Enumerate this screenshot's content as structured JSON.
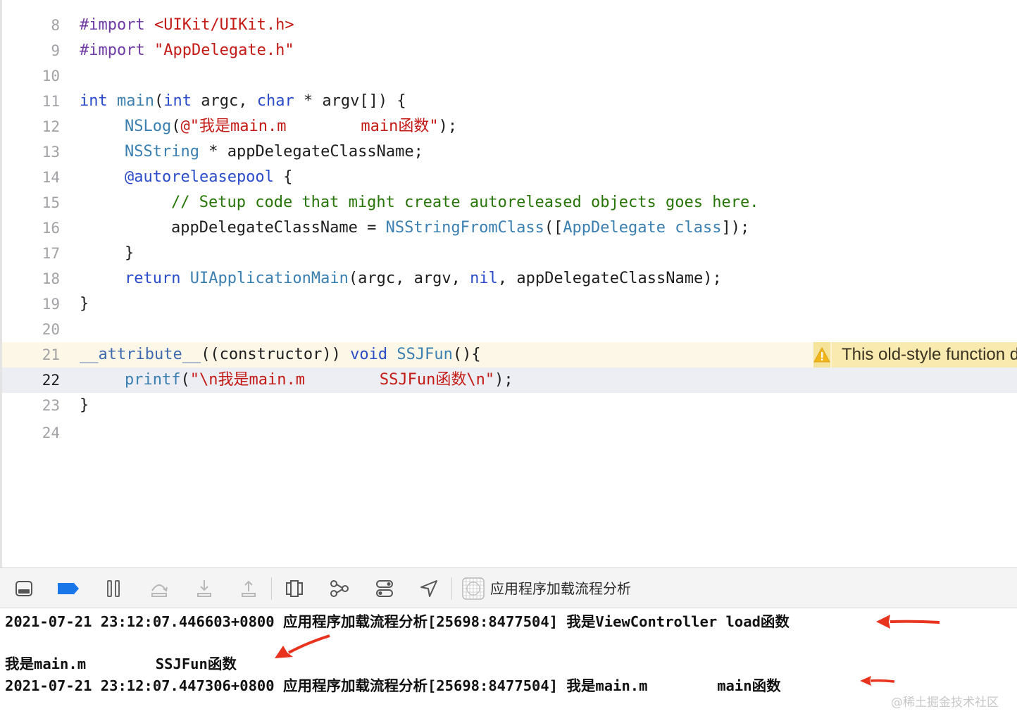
{
  "editor": {
    "lines": [
      {
        "n": "8"
      },
      {
        "n": "9"
      },
      {
        "n": "10"
      },
      {
        "n": "11"
      },
      {
        "n": "12"
      },
      {
        "n": "13"
      },
      {
        "n": "14"
      },
      {
        "n": "15"
      },
      {
        "n": "16"
      },
      {
        "n": "17"
      },
      {
        "n": "18"
      },
      {
        "n": "19"
      },
      {
        "n": "20"
      },
      {
        "n": "21"
      },
      {
        "n": "22"
      },
      {
        "n": "23"
      },
      {
        "n": "24"
      }
    ],
    "code": {
      "l8_a": "#import",
      "l8_b": "<UIKit/UIKit.h>",
      "l9_a": "#import",
      "l9_b": "\"AppDelegate.h\"",
      "l11_a": "int",
      "l11_b": "main",
      "l11_c": "(",
      "l11_d": "int",
      "l11_e": " argc, ",
      "l11_f": "char",
      "l11_g": " * argv[]) {",
      "l12_a": "NSLog",
      "l12_b": "(",
      "l12_c": "@\"我是main.m        main函数\"",
      "l12_d": ");",
      "l13_a": "NSString",
      "l13_b": " * appDelegateClassName;",
      "l14_a": "@autoreleasepool",
      "l14_b": " {",
      "l15_a": "// Setup code that might create autoreleased objects goes here.",
      "l16_a": "appDelegateClassName = ",
      "l16_b": "NSStringFromClass",
      "l16_c": "([",
      "l16_d": "AppDelegate",
      "l16_e": " ",
      "l16_f": "class",
      "l16_g": "]);",
      "l17_a": "}",
      "l18_a": "return",
      "l18_b": " ",
      "l18_c": "UIApplicationMain",
      "l18_d": "(argc, argv, ",
      "l18_e": "nil",
      "l18_f": ", appDelegateClassName);",
      "l19_a": "}",
      "l21_a": "__attribute__",
      "l21_b": "((constructor)) ",
      "l21_c": "void",
      "l21_d": " ",
      "l21_e": "SSJFun",
      "l21_f": "()",
      "l21_g": "{",
      "l22_a": "printf",
      "l22_b": "(",
      "l22_c": "\"\\n我是main.m        SSJFun函数\\n\"",
      "l22_d": ");",
      "l23_a": "}"
    },
    "warning": {
      "icon": "warning-triangle-icon",
      "text": "This old-style function definition is not preceded by a prototype"
    }
  },
  "debug_bar": {
    "buttons": [
      {
        "name": "hide-debug-area-icon"
      },
      {
        "name": "breakpoints-toggle-icon"
      },
      {
        "name": "pause-icon"
      },
      {
        "name": "step-over-icon"
      },
      {
        "name": "step-into-icon"
      },
      {
        "name": "step-out-icon"
      },
      {
        "name": "view-hierarchy-icon"
      },
      {
        "name": "memory-graph-icon"
      },
      {
        "name": "environment-overrides-icon"
      },
      {
        "name": "simulate-location-icon"
      }
    ],
    "process_label": "应用程序加载流程分析"
  },
  "console": {
    "lines": [
      "2021-07-21 23:12:07.446603+0800 应用程序加载流程分析[25698:8477504] 我是ViewController load函数",
      "我是main.m        SSJFun函数",
      "2021-07-21 23:12:07.447306+0800 应用程序加载流程分析[25698:8477504] 我是main.m        main函数"
    ],
    "watermark": "@稀土掘金技术社区"
  },
  "colors": {
    "keyword": "#9b2393",
    "string": "#c41a16",
    "comment": "#267507",
    "arrow": "#e8331f",
    "warning_bg": "#f9eab0"
  }
}
